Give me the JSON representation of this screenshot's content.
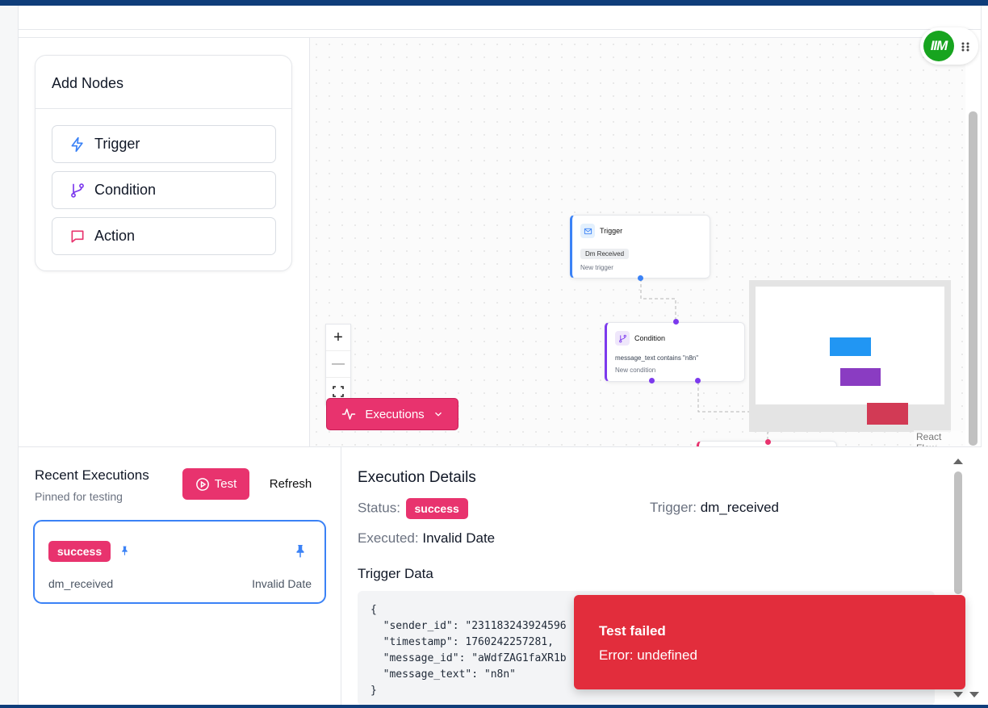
{
  "sidebar": {
    "title": "Add Nodes",
    "items": [
      {
        "label": "Trigger",
        "icon": "zap-icon",
        "color": "#3b82f6"
      },
      {
        "label": "Condition",
        "icon": "branch-icon",
        "color": "#7c3aed"
      },
      {
        "label": "Action",
        "icon": "message-icon",
        "color": "#e8336e"
      }
    ]
  },
  "canvas": {
    "trigger_node": {
      "title": "Trigger",
      "tag": "Dm Received",
      "subtitle": "New trigger"
    },
    "condition_node": {
      "title": "Condition",
      "rule": "message_text contains \"n8n\"",
      "subtitle": "New condition"
    },
    "executions_button": "Executions",
    "attribution": "React Flow",
    "controls": {
      "zoom_in": "+",
      "zoom_out": "—"
    },
    "minimap_colors": [
      "#2196f3",
      "#8a3cc2",
      "#d23a55"
    ],
    "logo_text": "IIM"
  },
  "executions": {
    "title": "Recent Executions",
    "subtitle": "Pinned for testing",
    "test_button": "Test",
    "refresh_button": "Refresh",
    "items": [
      {
        "status": "success",
        "trigger": "dm_received",
        "date": "Invalid Date"
      }
    ]
  },
  "details": {
    "title": "Execution Details",
    "status_label": "Status:",
    "status_value": "success",
    "trigger_label": "Trigger:",
    "trigger_value": "dm_received",
    "executed_label": "Executed:",
    "executed_value": "Invalid Date",
    "trigger_data_title": "Trigger Data",
    "trigger_data_code": "{\n  \"sender_id\": \"231183243924596\n  \"timestamp\": 1760242257281,\n  \"message_id\": \"aWdfZAG1faXR1b\n  \"message_text\": \"n8n\"\n}"
  },
  "toast": {
    "title": "Test failed",
    "message": "Error: undefined"
  },
  "colors": {
    "accent": "#e8336e",
    "selected_border": "#3b82f6",
    "toast_bg": "#e22d3c",
    "brand_dark": "#0f3d7a"
  }
}
